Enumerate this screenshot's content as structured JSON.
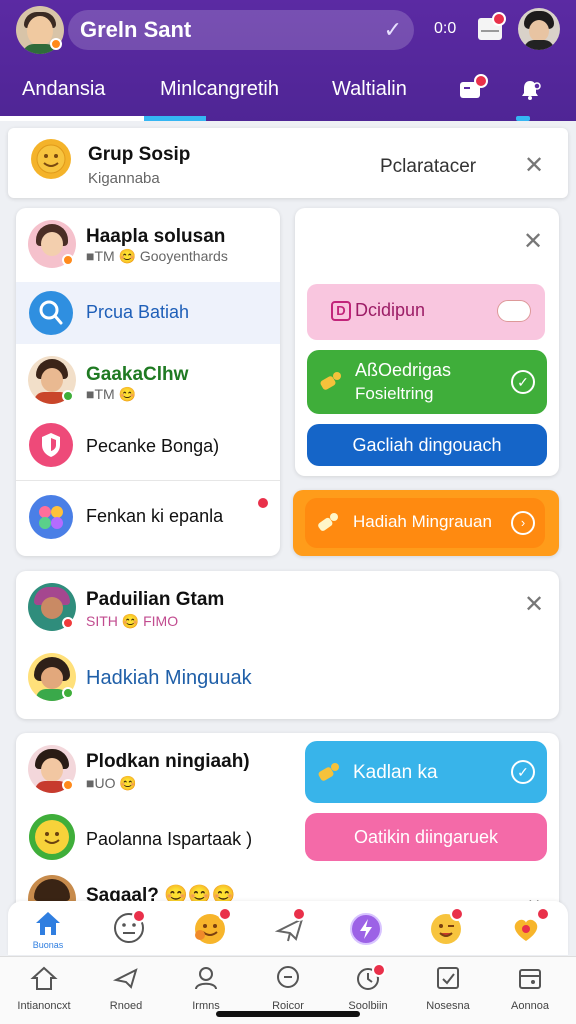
{
  "header": {
    "title": "Greln Sant",
    "time": "0:0",
    "tabs": [
      "Andansia",
      "Minlcangretih",
      "Waltialin"
    ]
  },
  "group": {
    "name": "Grup Sosip",
    "subtitle": "Kigannaba",
    "action": "Pclaratacer"
  },
  "left_card": {
    "rows": [
      {
        "name": "Haapla solusan",
        "sub": "■TM 😊 Gooyenthards"
      },
      {
        "label": "Prcua Batiah"
      },
      {
        "name": "GaakaClhw",
        "sub": "■TM 😊"
      },
      {
        "label": "Pecanke Bonga)"
      },
      {
        "label": "Fenkan ki epanla"
      }
    ]
  },
  "right_card": {
    "chip": "Dcidipun",
    "chip_prefix": "D",
    "green_button": "AßOedrigas Fosieltring",
    "green_line1": "AßOedrigas",
    "green_line2": "Fosieltring",
    "blue_button": "Gacliah dingouach"
  },
  "orange_button": "Hadiah Mingrauan",
  "card3": {
    "name": "Paduilian Gtam",
    "sub": "SITH 😊 FIMO",
    "link": "Hadkiah Minguuak"
  },
  "card4": {
    "row1_name": "Plodkan ningiaah)",
    "row1_sub": "■UO 😊",
    "row2_label": "Paolanna Ispartaak )",
    "row3_label": "Sagaal? 😊😊😊",
    "blue_button": "Kadlan ka",
    "pink_button": "Oatikin diingaruek"
  },
  "emoji_bar": {
    "first_label": "Buonas"
  },
  "nav": [
    {
      "icon": "home-icon",
      "label": "Intianoncxt"
    },
    {
      "icon": "plane-icon",
      "label": "Rnoed"
    },
    {
      "icon": "person-icon",
      "label": "Irmns"
    },
    {
      "icon": "chat-icon",
      "label": "Roicor"
    },
    {
      "icon": "clock-icon",
      "label": "Soolbiin"
    },
    {
      "icon": "check-icon",
      "label": "Nosesna"
    },
    {
      "icon": "calendar-icon",
      "label": "Aonnoa"
    }
  ],
  "colors": {
    "header": "#5b2aa3",
    "green": "#3fae3a",
    "blue": "#1565c8",
    "orange": "#ff9c1a",
    "cyan": "#38b4ea",
    "pink": "#f46aa8"
  }
}
